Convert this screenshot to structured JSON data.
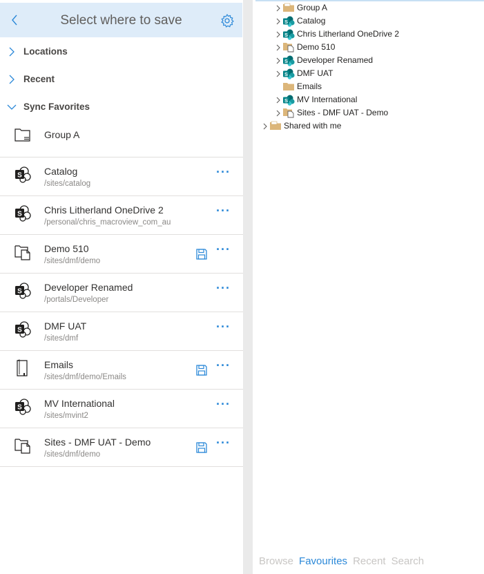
{
  "header": {
    "title": "Select where to save"
  },
  "sections": [
    {
      "label": "Locations",
      "expanded": false
    },
    {
      "label": "Recent",
      "expanded": false
    },
    {
      "label": "Sync Favorites",
      "expanded": true
    }
  ],
  "favorites": [
    {
      "name": "Group A",
      "path": "",
      "icon": "group-icon",
      "save": false,
      "more": false
    },
    {
      "name": "Catalog",
      "path": "/sites/catalog",
      "icon": "sharepoint-icon",
      "save": false,
      "more": true
    },
    {
      "name": "Chris Litherland OneDrive 2",
      "path": "/personal/chris_macroview_com_au",
      "icon": "sharepoint-icon",
      "save": false,
      "more": true
    },
    {
      "name": "Demo 510",
      "path": "/sites/dmf/demo",
      "icon": "library-icon",
      "save": true,
      "more": true
    },
    {
      "name": "Developer Renamed",
      "path": "/portals/Developer",
      "icon": "sharepoint-icon",
      "save": false,
      "more": true
    },
    {
      "name": "DMF UAT",
      "path": "/sites/dmf",
      "icon": "sharepoint-icon",
      "save": false,
      "more": true
    },
    {
      "name": "Emails",
      "path": "/sites/dmf/demo/Emails",
      "icon": "folder-icon",
      "save": true,
      "more": true
    },
    {
      "name": "MV International",
      "path": "/sites/mvint2",
      "icon": "sharepoint-icon",
      "save": false,
      "more": true
    },
    {
      "name": "Sites - DMF UAT - Demo",
      "path": "/sites/dmf/demo",
      "icon": "library-icon",
      "save": true,
      "more": true
    }
  ],
  "more_label": "···",
  "tree": [
    {
      "label": "Group A",
      "icon": "group-folder-icon",
      "chevron": true,
      "level": 1
    },
    {
      "label": "Catalog",
      "icon": "sharepoint-icon",
      "chevron": true,
      "level": 1
    },
    {
      "label": "Chris Litherland OneDrive 2",
      "icon": "sharepoint-icon",
      "chevron": true,
      "level": 1
    },
    {
      "label": "Demo 510",
      "icon": "library-folder-icon",
      "chevron": true,
      "level": 1
    },
    {
      "label": "Developer Renamed",
      "icon": "sharepoint-icon",
      "chevron": true,
      "level": 1
    },
    {
      "label": "DMF UAT",
      "icon": "sharepoint-icon",
      "chevron": true,
      "level": 1
    },
    {
      "label": "Emails",
      "icon": "folder-icon",
      "chevron": false,
      "level": 1
    },
    {
      "label": "MV International",
      "icon": "sharepoint-icon",
      "chevron": true,
      "level": 1
    },
    {
      "label": "Sites - DMF UAT - Demo",
      "icon": "library-folder-icon",
      "chevron": true,
      "level": 1
    },
    {
      "label": "Shared with me",
      "icon": "shared-folder-icon",
      "chevron": true,
      "level": 0
    }
  ],
  "bottom_tabs": [
    {
      "label": "Browse",
      "active": false
    },
    {
      "label": "Favourites",
      "active": true
    },
    {
      "label": "Recent",
      "active": false
    },
    {
      "label": "Search",
      "active": false
    }
  ],
  "colors": {
    "accent": "#2b88d8",
    "header_bg": "#deecf9",
    "sharepoint": "#038387",
    "folder": "#dcb67a"
  }
}
